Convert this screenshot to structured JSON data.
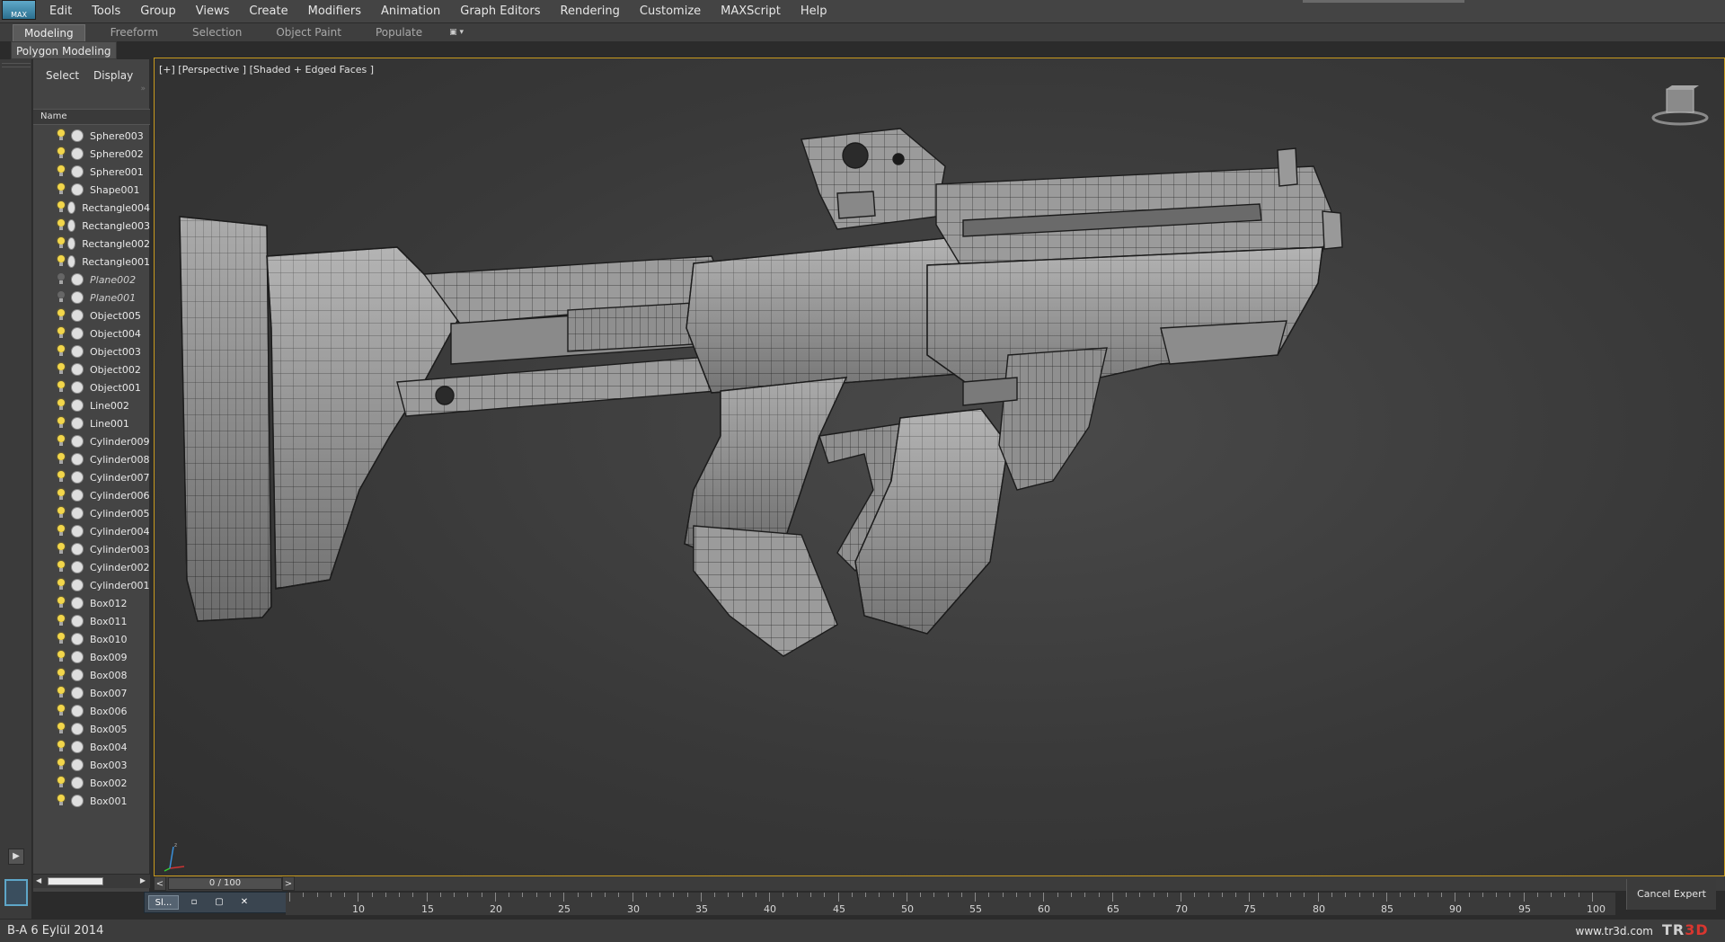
{
  "app": {
    "logo_text": "MAX",
    "colors": {
      "viewport_border": "#c89a1d",
      "accent_blue": "#5ea6c8",
      "logo_red": "#d9362f"
    }
  },
  "menu": [
    "Edit",
    "Tools",
    "Group",
    "Views",
    "Create",
    "Modifiers",
    "Animation",
    "Graph Editors",
    "Rendering",
    "Customize",
    "MAXScript",
    "Help"
  ],
  "ribbon": {
    "tabs": [
      "Modeling",
      "Freeform",
      "Selection",
      "Object Paint",
      "Populate"
    ],
    "active": "Modeling",
    "panel_label": "Polygon Modeling"
  },
  "explorer": {
    "tabs": [
      "Select",
      "Display"
    ],
    "column_header": "Name",
    "items": [
      {
        "name": "Sphere003",
        "italic": false
      },
      {
        "name": "Sphere002",
        "italic": false
      },
      {
        "name": "Sphere001",
        "italic": false
      },
      {
        "name": "Shape001",
        "italic": false
      },
      {
        "name": "Rectangle004",
        "italic": false
      },
      {
        "name": "Rectangle003",
        "italic": false
      },
      {
        "name": "Rectangle002",
        "italic": false
      },
      {
        "name": "Rectangle001",
        "italic": false
      },
      {
        "name": "Plane002",
        "italic": true
      },
      {
        "name": "Plane001",
        "italic": true
      },
      {
        "name": "Object005",
        "italic": false
      },
      {
        "name": "Object004",
        "italic": false
      },
      {
        "name": "Object003",
        "italic": false
      },
      {
        "name": "Object002",
        "italic": false
      },
      {
        "name": "Object001",
        "italic": false
      },
      {
        "name": "Line002",
        "italic": false
      },
      {
        "name": "Line001",
        "italic": false
      },
      {
        "name": "Cylinder009",
        "italic": false
      },
      {
        "name": "Cylinder008",
        "italic": false
      },
      {
        "name": "Cylinder007",
        "italic": false
      },
      {
        "name": "Cylinder006",
        "italic": false
      },
      {
        "name": "Cylinder005",
        "italic": false
      },
      {
        "name": "Cylinder004",
        "italic": false
      },
      {
        "name": "Cylinder003",
        "italic": false
      },
      {
        "name": "Cylinder002",
        "italic": false
      },
      {
        "name": "Cylinder001",
        "italic": false
      },
      {
        "name": "Box012",
        "italic": false
      },
      {
        "name": "Box011",
        "italic": false
      },
      {
        "name": "Box010",
        "italic": false
      },
      {
        "name": "Box009",
        "italic": false
      },
      {
        "name": "Box008",
        "italic": false
      },
      {
        "name": "Box007",
        "italic": false
      },
      {
        "name": "Box006",
        "italic": false
      },
      {
        "name": "Box005",
        "italic": false
      },
      {
        "name": "Box004",
        "italic": false
      },
      {
        "name": "Box003",
        "italic": false
      },
      {
        "name": "Box002",
        "italic": false
      },
      {
        "name": "Box001",
        "italic": false
      }
    ]
  },
  "viewport": {
    "label": "[+] [Perspective ] [Shaded + Edged Faces ]"
  },
  "timeline": {
    "frame_display": "0 / 100",
    "prev": "<",
    "next": ">",
    "ticks": [
      "10",
      "15",
      "20",
      "25",
      "30",
      "35",
      "40",
      "45",
      "50",
      "55",
      "60",
      "65",
      "70",
      "75",
      "80",
      "85",
      "90",
      "95",
      "100"
    ]
  },
  "taskbar": {
    "app_label": "Sl...",
    "buttons": [
      "▫",
      "▢",
      "✕"
    ]
  },
  "expert_mode": "Cancel Expert Mode",
  "status": {
    "left_text": "B-A 6 Eylül 2014",
    "url": "www.tr3d.com",
    "logo_prefix": "TR",
    "logo_suffix": "3D"
  }
}
